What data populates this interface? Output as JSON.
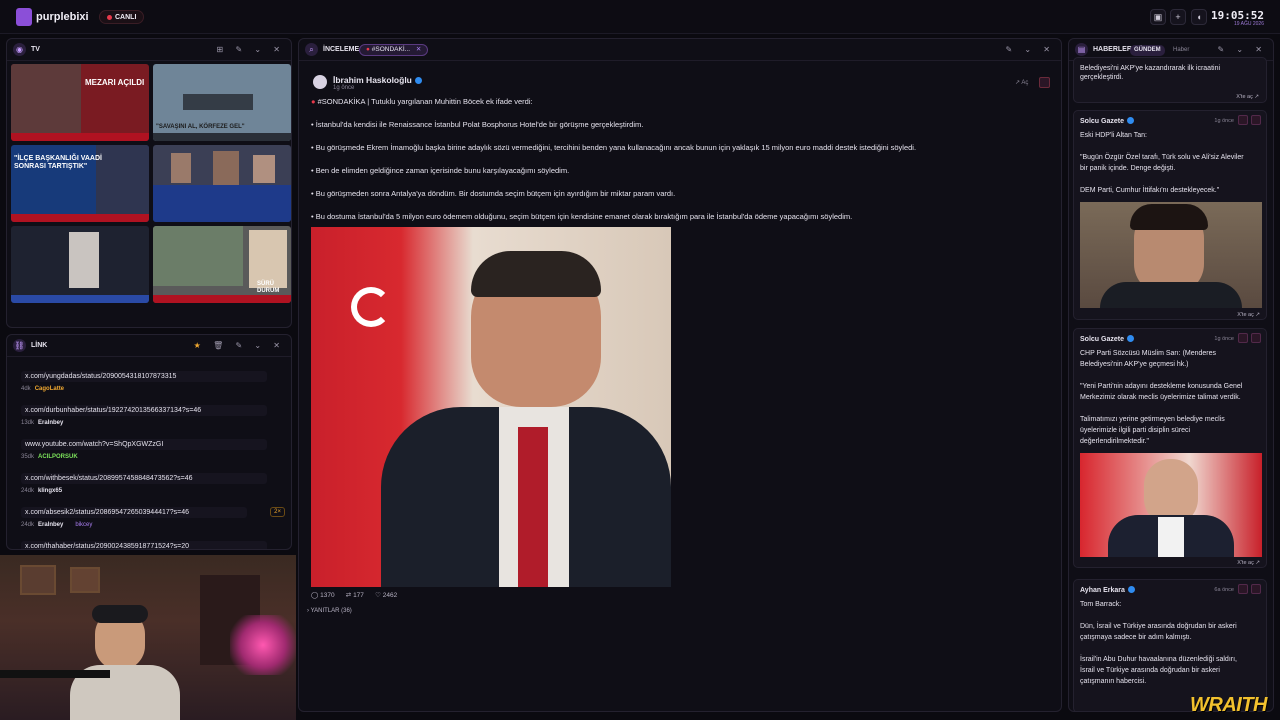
{
  "app": {
    "brand": "purplebixi",
    "live_label": "CANLI",
    "clock": "19:05:52",
    "date": "19 AĞU 2026",
    "icons": [
      "image-icon",
      "plus-icon",
      "volume-icon"
    ]
  },
  "tv_panel": {
    "title": "TV",
    "controls": [
      "grid-icon",
      "edit-icon",
      "chevron-down-icon",
      "close-icon"
    ],
    "feeds": [
      {
        "caption": "MEZARI AÇILDI",
        "bg": "#7a1b22"
      },
      {
        "caption": "\"SAVAŞINI AL, KÖRFEZE GEL\"",
        "bg": "#6f8598"
      },
      {
        "caption": "\"İLÇE BAŞKANLIĞI VAADİ SONRASI TARTIŞTIK\"",
        "bg": "#173a7a"
      },
      {
        "caption": "",
        "bg": "#3b3f55"
      },
      {
        "caption": "",
        "bg": "#1e2230"
      },
      {
        "caption": "SÜRÜ DURUM",
        "bg": "#5a5a5a"
      }
    ]
  },
  "link_panel": {
    "title": "LİNK",
    "items": [
      {
        "url": "x.com/yungdadas/status/2090054318107873315",
        "age": "4dk",
        "user": "CagoLatte",
        "extra": "",
        "badge": ""
      },
      {
        "url": "x.com/durbunhaber/status/1922742013566337134?s=46",
        "age": "13dk",
        "user": "Eralnbey",
        "extra": "",
        "badge": ""
      },
      {
        "url": "www.youtube.com/watch?v=ShQpXGWZzGI",
        "age": "35dk",
        "user": "ACILPORSUK",
        "extra": "",
        "badge": ""
      },
      {
        "url": "x.com/withbesek/status/2089957458848473562?s=46",
        "age": "24dk",
        "user": "klingx65",
        "extra": "",
        "badge": ""
      },
      {
        "url": "x.com/absesik2/status/2086954726503944417?s=46",
        "age": "24dk",
        "user": "Eralnbey",
        "extra": "bikcey",
        "badge": "2×"
      },
      {
        "url": "x.com/thahaber/status/2090024385918771524?s=20",
        "age": "",
        "user": "",
        "extra": "",
        "badge": ""
      }
    ]
  },
  "inceleme_panel": {
    "title": "İNCELEME",
    "tag": "#SONDAKİ...",
    "author": "İbrahim Haskoloğlu",
    "time": "1g önce",
    "open_label": "Aç",
    "lines": [
      "#SONDAKİKA | Tutuklu yargılanan Muhittin Böcek ek ifade verdi:",
      "• İstanbul'da kendisi ile Renaissance İstanbul Polat Bosphorus Hotel'de bir görüşme gerçekleştirdim.",
      "• Bu görüşmede Ekrem İmamoğlu başka birine adaylık sözü vermediğini, tercihini benden yana kullanacağını ancak bunun için yaklaşık 15 milyon euro maddi destek istediğini söyledi.",
      "• Ben de elimden geldiğince zaman içerisinde bunu karşılayacağımı söyledim.",
      "• Bu görüşmeden sonra Antalya'ya döndüm. Bir dostumda seçim bütçem için ayırdığım bir miktar param vardı.",
      "• Bu dostuma İstanbul'da 5 milyon euro ödemem olduğunu, seçim bütçem için kendisine emanet olarak bıraktığım para ile İstanbul'da ödeme yapacağımı söyledim."
    ],
    "stats": {
      "replies": "1370",
      "retweets": "177",
      "likes": "2462"
    },
    "replies_label": "YANITLAR (36)"
  },
  "haberler_panel": {
    "title": "HABERLER",
    "tab_active": "GÜNDEM",
    "tab_inactive": "Haber",
    "x_link_label": "X'te aç",
    "top_snippet": [
      "Belediyesi'ni AKP'ye kazandırarak ilk icraatini",
      "gerçekleştirdi."
    ],
    "cards": [
      {
        "source": "Solcu Gazete",
        "time": "1g önce",
        "lines": [
          "Eski HDP'li Altan Tan:",
          "",
          "\"Bugün Özgür Özel tarafı, Türk solu ve Ali'siz Aleviler",
          "bir panik içinde. Denge değişti.",
          "",
          "DEM Parti, Cumhur İttifakı'nı destekleyecek.\""
        ]
      },
      {
        "source": "Solcu Gazete",
        "time": "1g önce",
        "lines": [
          "CHP Parti Sözcüsü Müslim Sarı: (Menderes",
          "Belediyesi'nin AKP'ye geçmesi hk.)",
          "",
          "\"Yeni Parti'nin adayını destekleme konusunda Genel",
          "Merkezimiz olarak meclis üyelerimize talimat verdik.",
          "",
          "Talimatımızı yerine getirmeyen belediye meclis",
          "üyelerimizle ilgili parti disiplin süreci",
          "değerlendirilmektedir.\""
        ]
      },
      {
        "source": "Ayhan Erkara",
        "time": "6a önce",
        "lines": [
          "Tom Barrack:",
          "",
          "Dün, İsrail ve Türkiye arasında doğrudan bir askeri",
          "çatışmaya sadece bir adım kalmıştı.",
          "",
          "İsrail'in Abu Duhur havaalanına düzenlediği saldırı,",
          "İsrail ve Türkiye arasında doğrudan bir askeri",
          "çatışmanın habercisi."
        ]
      }
    ]
  },
  "overlay": {
    "watermark": "WRAITH"
  },
  "colors": {
    "accent": "#a87df0",
    "live": "#e7394b",
    "verified": "#2f8cf0",
    "badge": "#f0a830"
  }
}
